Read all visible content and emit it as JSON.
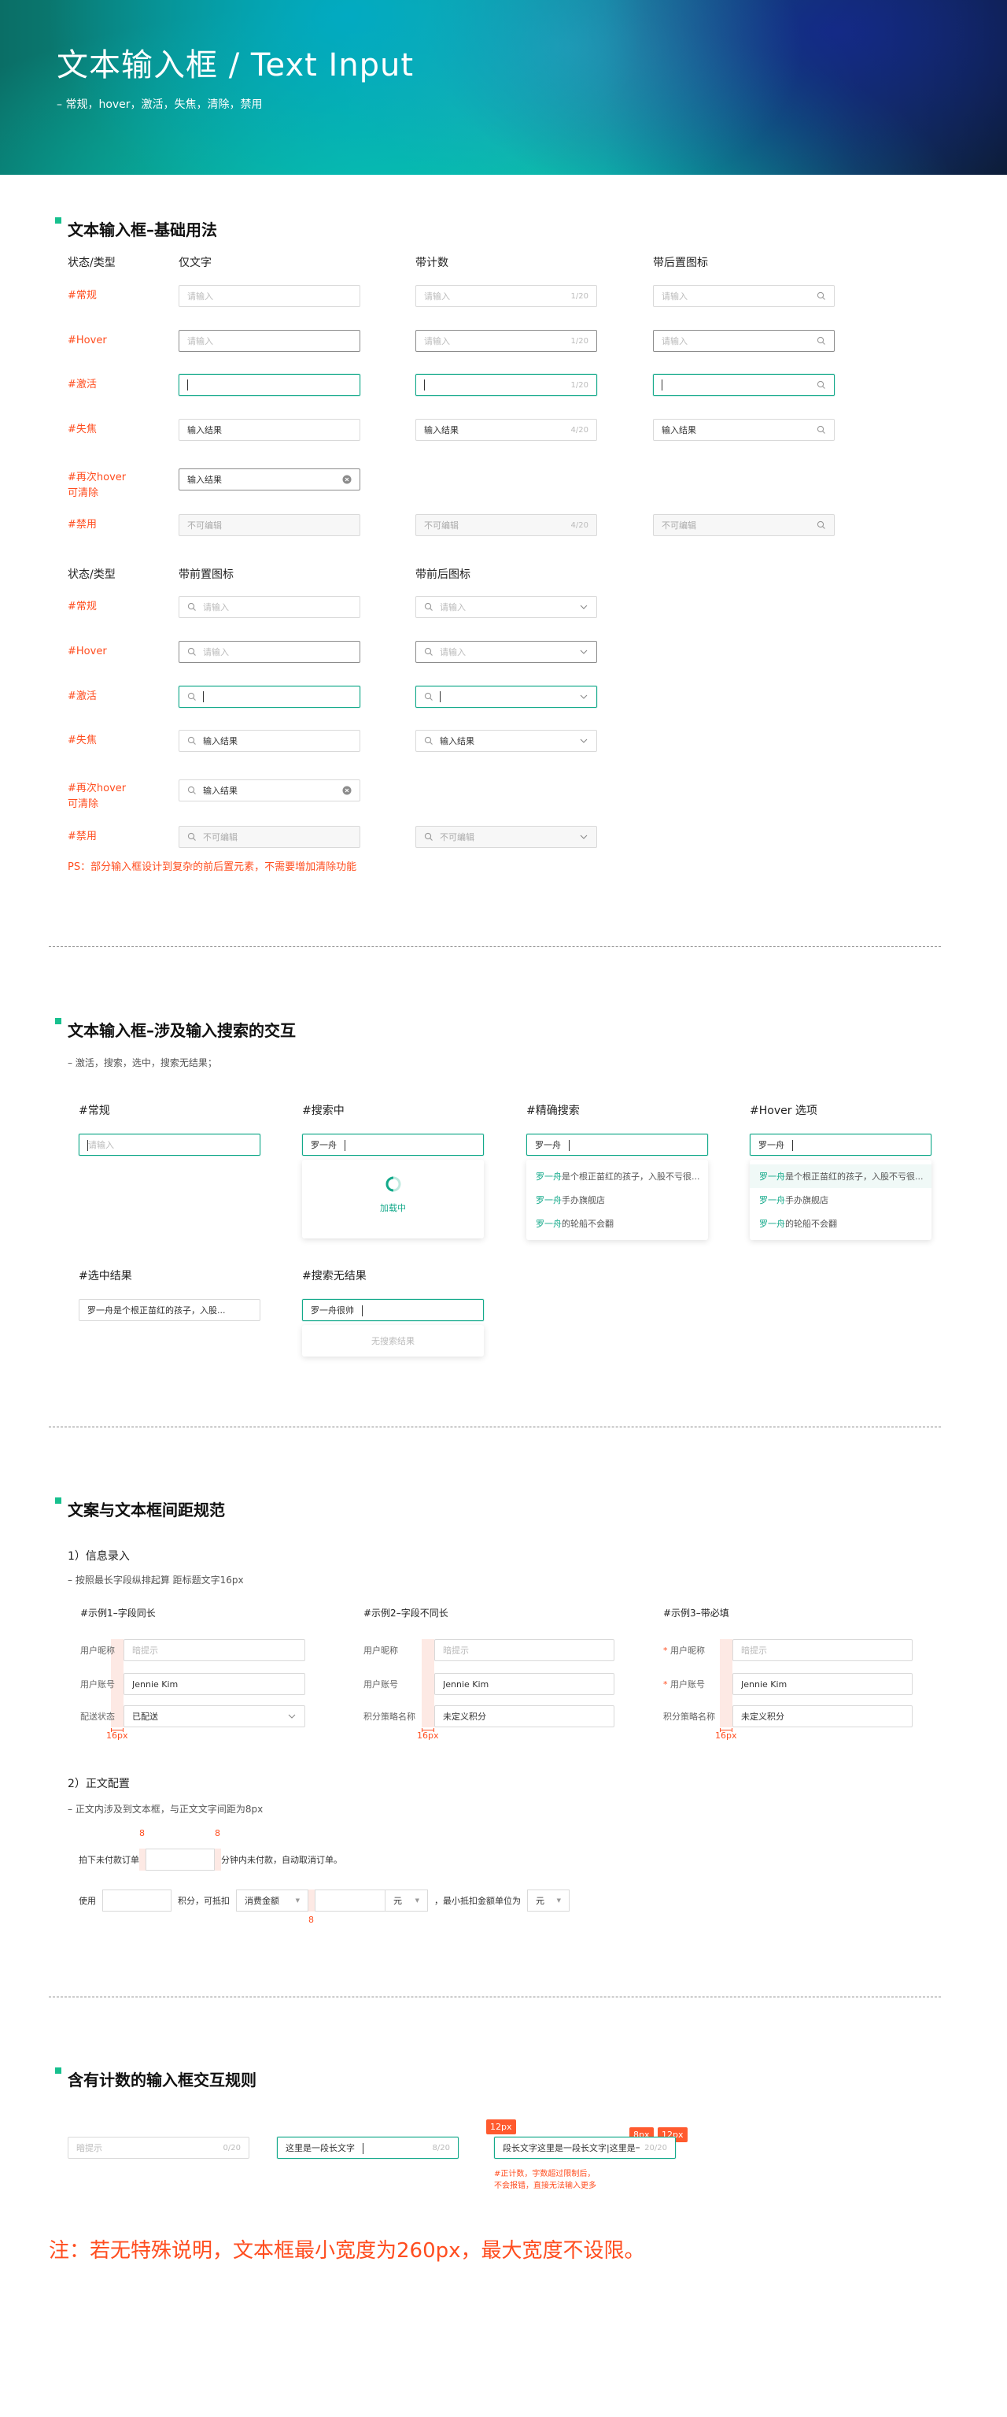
{
  "header": {
    "title": "文本输入框 / Text Input",
    "subtitle": "– 常规，hover，激活，失焦，清除，禁用"
  },
  "colors": {
    "accent": "#13a98a",
    "label_red": "#ff4d1f",
    "border": "#d9d9d9",
    "hover_border": "#8c8c8c"
  },
  "basic": {
    "title": "文本输入框–基础用法",
    "table1": {
      "headers": [
        "状态/类型",
        "仅文字",
        "带计数",
        "带后置图标"
      ],
      "rows": [
        {
          "label": "#常规",
          "cells": [
            {
              "state": "normal",
              "placeholder": "请输入"
            },
            {
              "state": "normal",
              "placeholder": "请输入",
              "counter": "1/20"
            },
            {
              "state": "normal",
              "placeholder": "请输入",
              "suffix": "search"
            }
          ]
        },
        {
          "label": "#Hover",
          "cells": [
            {
              "state": "hover",
              "placeholder": "请输入"
            },
            {
              "state": "hover",
              "placeholder": "请输入",
              "counter": "1/20"
            },
            {
              "state": "hover",
              "placeholder": "请输入",
              "suffix": "search"
            }
          ]
        },
        {
          "label": "#激活",
          "cells": [
            {
              "state": "active",
              "caret": true
            },
            {
              "state": "active",
              "caret": true,
              "counter": "1/20"
            },
            {
              "state": "active",
              "caret": true,
              "suffix": "search"
            }
          ]
        },
        {
          "label": "#失焦",
          "cells": [
            {
              "state": "normal",
              "value": "输入结果"
            },
            {
              "state": "normal",
              "value": "输入结果",
              "counter": "4/20"
            },
            {
              "state": "normal",
              "value": "输入结果",
              "suffix": "search"
            }
          ]
        },
        {
          "label": "#再次hover\n可清除",
          "cells": [
            {
              "state": "hover",
              "value": "输入结果",
              "suffix": "clear"
            }
          ]
        },
        {
          "label": "#禁用",
          "cells": [
            {
              "state": "disabled",
              "value": "不可编辑"
            },
            {
              "state": "disabled",
              "value": "不可编辑",
              "counter": "4/20"
            },
            {
              "state": "disabled",
              "value": "不可编辑",
              "suffix": "search"
            }
          ]
        }
      ]
    },
    "table2": {
      "headers": [
        "状态/类型",
        "带前置图标",
        "带前后图标"
      ],
      "rows": [
        {
          "label": "#常规",
          "cells": [
            {
              "state": "normal",
              "prefix": true,
              "placeholder": "请输入"
            },
            {
              "state": "normal",
              "prefix": true,
              "placeholder": "请输入",
              "suffix": "chevron"
            }
          ]
        },
        {
          "label": "#Hover",
          "cells": [
            {
              "state": "hover",
              "prefix": true,
              "placeholder": "请输入"
            },
            {
              "state": "hover",
              "prefix": true,
              "placeholder": "请输入",
              "suffix": "chevron"
            }
          ]
        },
        {
          "label": "#激活",
          "cells": [
            {
              "state": "active",
              "prefix": true,
              "caret": true
            },
            {
              "state": "active",
              "prefix": true,
              "caret": true,
              "suffix": "chevron"
            }
          ]
        },
        {
          "label": "#失焦",
          "cells": [
            {
              "state": "normal",
              "prefix": true,
              "value": "输入结果"
            },
            {
              "state": "normal",
              "prefix": true,
              "value": "输入结果",
              "suffix": "chevron"
            }
          ]
        },
        {
          "label": "#再次hover\n可清除",
          "cells": [
            {
              "state": "normal",
              "prefix": true,
              "value": "输入结果",
              "suffix": "clear"
            }
          ]
        },
        {
          "label": "#禁用",
          "cells": [
            {
              "state": "disabled",
              "prefix": true,
              "value": "不可编辑"
            },
            {
              "state": "disabled",
              "prefix": true,
              "value": "不可编辑",
              "suffix": "chevron"
            }
          ]
        }
      ]
    },
    "ps": "PS：部分输入框设计到复杂的前后置元素，不需要增加清除功能"
  },
  "search": {
    "title": "文本输入框–涉及输入搜索的交互",
    "subtitle": "– 激活，搜索，选中，搜索无结果；",
    "cards": [
      {
        "label": "#常规",
        "input": {
          "state": "active",
          "placeholder": "请输入",
          "caret_first": true
        }
      },
      {
        "label": "#搜索中",
        "input": {
          "state": "active",
          "value": "罗一舟",
          "caret": true
        },
        "loading": "加载中"
      },
      {
        "label": "#精确搜索",
        "input": {
          "state": "active",
          "value": "罗一舟",
          "caret": true
        },
        "options": [
          {
            "hl": "罗一舟",
            "rest": "是个根正苗红的孩子，入股不亏很..."
          },
          {
            "hl": "罗一舟",
            "rest": "手办旗舰店"
          },
          {
            "hl": "罗一舟",
            "rest": "的轮船不会翻"
          }
        ]
      },
      {
        "label": "#Hover 选项",
        "input": {
          "state": "active",
          "value": "罗一舟",
          "caret": true
        },
        "hover_index": 0,
        "options": [
          {
            "hl": "罗一舟",
            "rest": "是个根正苗红的孩子，入股不亏很..."
          },
          {
            "hl": "罗一舟",
            "rest": "手办旗舰店"
          },
          {
            "hl": "罗一舟",
            "rest": "的轮船不会翻"
          }
        ]
      },
      {
        "label": "#选中结果",
        "input": {
          "state": "normal",
          "value": "罗一舟是个根正苗红的孩子，入股..."
        }
      },
      {
        "label": "#搜索无结果",
        "input": {
          "state": "active",
          "value": "罗一舟很帅",
          "caret": true
        },
        "empty": "无搜索结果"
      }
    ]
  },
  "spacing": {
    "title": "文案与文本框间距规范",
    "part1": {
      "title": "1）信息录入",
      "subtitle": "– 按照最长字段纵排起算 距标题文字16px",
      "measure": "16px",
      "examples": [
        {
          "title": "#示例1–字段同长",
          "rows": [
            {
              "label": "用户昵称",
              "placeholder": "暗提示"
            },
            {
              "label": "用户账号",
              "value": "Jennie Kim"
            },
            {
              "label": "配送状态",
              "value": "已配送",
              "suffix": "chevron"
            }
          ]
        },
        {
          "title": "#示例2–字段不同长",
          "rows": [
            {
              "label": "用户昵称",
              "placeholder": "暗提示"
            },
            {
              "label": "用户账号",
              "value": "Jennie Kim"
            },
            {
              "label": "积分策略名称",
              "value": "未定义积分"
            }
          ]
        },
        {
          "title": "#示例3–带必填",
          "rows": [
            {
              "label": "用户昵称",
              "required": true,
              "placeholder": "暗提示"
            },
            {
              "label": "用户账号",
              "required": true,
              "value": "Jennie Kim"
            },
            {
              "label": "积分策略名称",
              "value": "未定义积分"
            }
          ]
        }
      ]
    },
    "part2": {
      "title": "2）正文配置",
      "subtitle": "– 正文内涉及到文本框，与正文文字间距为8px",
      "measure": "8",
      "line1": {
        "before": "拍下未付款订单",
        "after": "分钟内未付款，自动取消订单。"
      },
      "line2": {
        "t1": "使用",
        "t2": "积分，可抵扣",
        "select1": "消费金额",
        "unit1": "元",
        "t3": "，最小抵扣金额单位为",
        "unit2": "元"
      }
    }
  },
  "counter": {
    "title": "含有计数的输入框交互规则",
    "inputs": [
      {
        "state": "normal",
        "placeholder": "暗提示",
        "counter": "0/20"
      },
      {
        "state": "active",
        "value": "这里是一段长文字",
        "caret": true,
        "counter": "8/20"
      },
      {
        "state": "active",
        "value": "段长文字这里是一段长文字|这里是一段",
        "counter": "20/20"
      }
    ],
    "tags": [
      "12px",
      "8px",
      "12px"
    ],
    "annotation": "#正计数，字数超过限制后，\n不会报错，直接无法输入更多"
  },
  "footer_note": "注：若无特殊说明，文本框最小宽度为260px，最大宽度不设限。"
}
